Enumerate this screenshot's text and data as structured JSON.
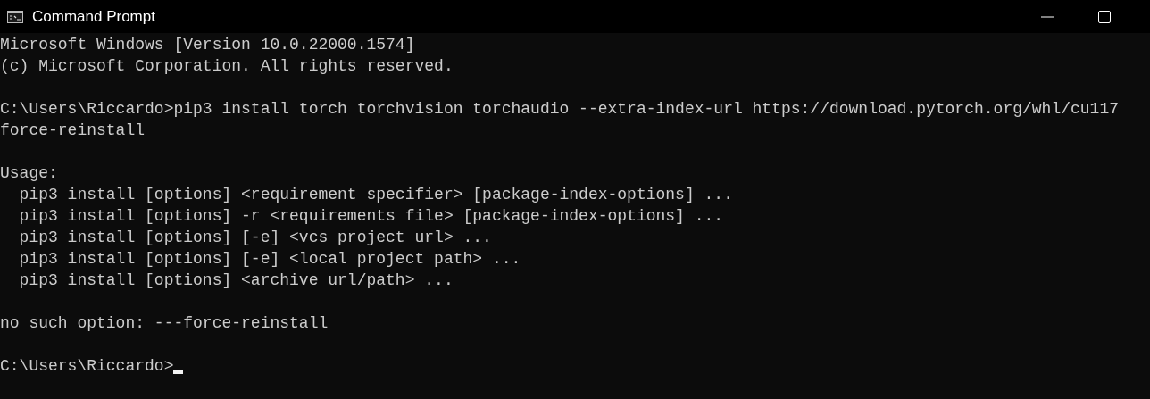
{
  "window": {
    "title": "Command Prompt"
  },
  "console": {
    "blocks": [
      {
        "lines": [
          "Microsoft Windows [Version 10.0.22000.1574]",
          "(c) Microsoft Corporation. All rights reserved."
        ]
      },
      {
        "lines": [
          "C:\\Users\\Riccardo>pip3 install torch torchvision torchaudio --extra-index-url https://download.pytorch.org/whl/cu117",
          "force-reinstall"
        ]
      },
      {
        "lines": [
          "Usage:",
          "  pip3 install [options] <requirement specifier> [package-index-options] ...",
          "  pip3 install [options] -r <requirements file> [package-index-options] ...",
          "  pip3 install [options] [-e] <vcs project url> ...",
          "  pip3 install [options] [-e] <local project path> ...",
          "  pip3 install [options] <archive url/path> ..."
        ]
      },
      {
        "lines": [
          "no such option: ---force-reinstall"
        ]
      }
    ],
    "prompt": "C:\\Users\\Riccardo>"
  }
}
